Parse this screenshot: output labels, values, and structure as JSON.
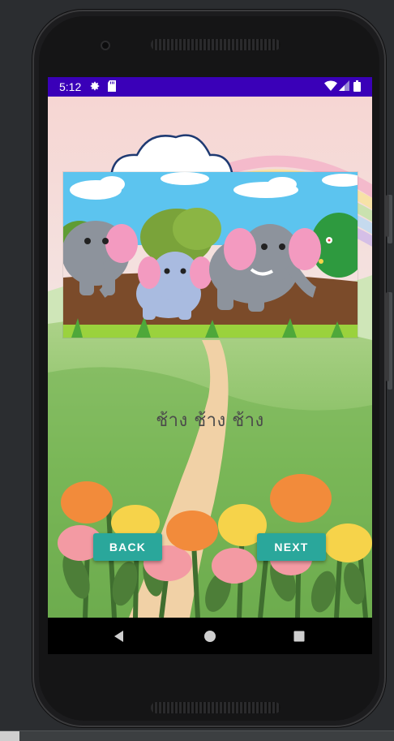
{
  "status_bar": {
    "time": "5:12",
    "icons": [
      "settings-icon",
      "sd-card-icon",
      "wifi-icon",
      "signal-icon",
      "battery-icon"
    ],
    "color": "#3a00b8"
  },
  "story": {
    "image": "elephants-illustration",
    "caption": "ช้าง ช้าง ช้าง"
  },
  "buttons": {
    "back_label": "BACK",
    "next_label": "NEXT",
    "color": "#2aa79b"
  },
  "nav_bar": {
    "items": [
      "back-triangle-icon",
      "home-circle-icon",
      "recents-square-icon"
    ]
  }
}
